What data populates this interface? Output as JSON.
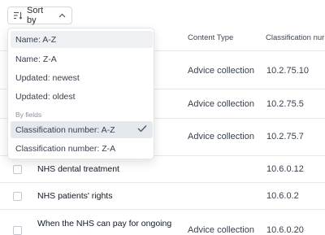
{
  "sort_button": {
    "label": "Sort by",
    "icon": "sort-icon",
    "chevron": "chevron-up-icon"
  },
  "table": {
    "headers": {
      "content_type": "Content Type",
      "classification": "Classification nur"
    },
    "rows": [
      {
        "title": "",
        "content_type": "Advice collection",
        "classification": "10.2.75.10"
      },
      {
        "title": "",
        "content_type": "Advice collection",
        "classification": "10.2.75.5"
      },
      {
        "title": "",
        "content_type": "Advice collection",
        "classification": "10.2.75.7"
      },
      {
        "title": "NHS dental treatment",
        "content_type": "",
        "classification": "10.6.0.12"
      },
      {
        "title": "NHS patients' rights",
        "content_type": "",
        "classification": "10.6.0.2"
      },
      {
        "title": "When the NHS can pay for ongoing",
        "content_type": "Advice collection",
        "classification": "10.6.0.20"
      }
    ]
  },
  "dropdown": {
    "options": [
      "Name: A-Z",
      "Name: Z-A",
      "Updated: newest",
      "Updated: oldest"
    ],
    "section_label": "By fields",
    "field_options": [
      "Classification number: A-Z",
      "Classification number: Z-A"
    ],
    "selected": "Classification number: A-Z",
    "hovered": "Name: A-Z"
  }
}
